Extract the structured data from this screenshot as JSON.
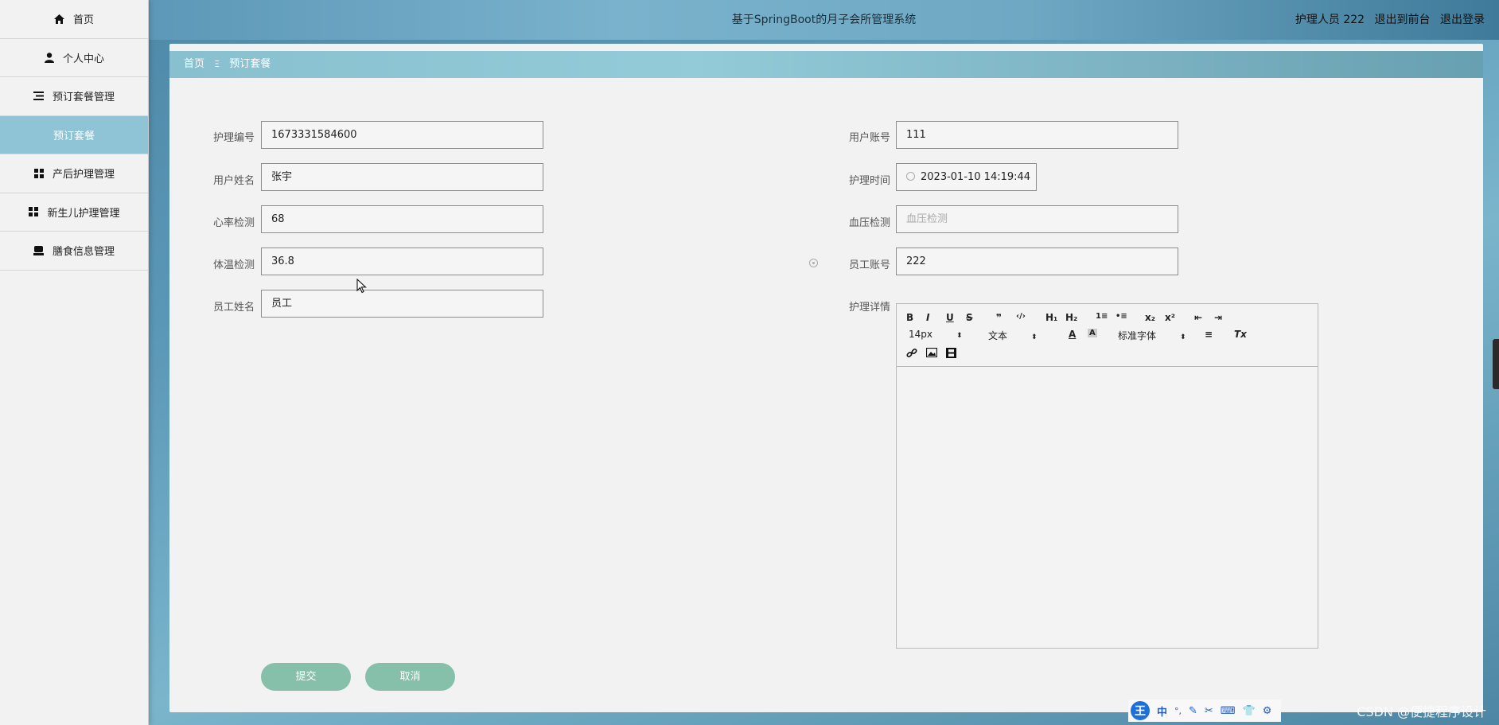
{
  "app": {
    "title": "基于SpringBoot的月子会所管理系统",
    "user_label": "护理人员 222",
    "to_front": "退出到前台",
    "logout": "退出登录"
  },
  "sidebar": {
    "items": [
      {
        "label": "首页",
        "icon": "home-icon"
      },
      {
        "label": "个人中心",
        "icon": "user-icon"
      },
      {
        "label": "预订套餐管理",
        "icon": "list-icon"
      },
      {
        "label": "预订套餐",
        "icon": ""
      },
      {
        "label": "产后护理管理",
        "icon": "grid-icon"
      },
      {
        "label": "新生儿护理管理",
        "icon": "grid-icon"
      },
      {
        "label": "膳食信息管理",
        "icon": "tray-icon"
      }
    ],
    "active_index": 3
  },
  "breadcrumb": {
    "home": "首页",
    "sep": "Ξ",
    "current": "预订套餐"
  },
  "form": {
    "left": [
      {
        "label": "护理编号",
        "value": "1673331584600"
      },
      {
        "label": "用户姓名",
        "value": "张宇"
      },
      {
        "label": "心率检测",
        "value": "68"
      },
      {
        "label": "体温检测",
        "value": "36.8"
      },
      {
        "label": "员工姓名",
        "value": "员工"
      }
    ],
    "right": [
      {
        "label": "用户账号",
        "value": "111"
      },
      {
        "label": "护理时间",
        "value": "2023-01-10 14:19:44"
      },
      {
        "label": "血压检测",
        "value": "",
        "placeholder": "血压检测"
      },
      {
        "label": "员工账号",
        "value": "222"
      }
    ],
    "detail_label": "护理详情"
  },
  "editor": {
    "row1": [
      "B",
      "I",
      "U",
      "S",
      "❞",
      "‹/›",
      "H₁",
      "H₂",
      "1≡",
      "•≡",
      "x₂",
      "x²",
      "⇤",
      "⇥"
    ],
    "font_size": "14px",
    "text_type": "文本",
    "font_color": "A",
    "bg_color": "A",
    "font_family": "标准字体",
    "align": "≡",
    "clear": "Tx"
  },
  "buttons": {
    "submit": "提交",
    "cancel": "取消"
  },
  "ime": {
    "logo": "王",
    "mode": "中",
    "punct": "°,"
  },
  "watermark": "CSDN @便捷程序设计",
  "colors": {
    "accent": "#8ec4d5",
    "button": "#86c0aa",
    "header": "#6ea8c3"
  }
}
